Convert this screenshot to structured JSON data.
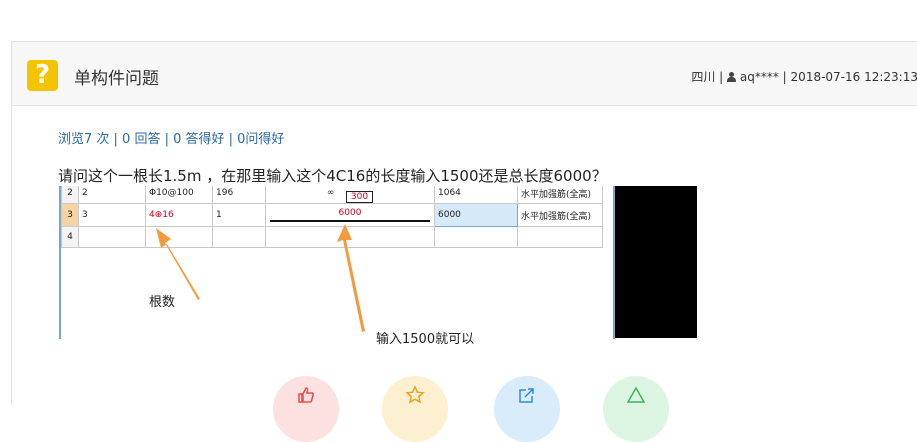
{
  "header": {
    "icon": "question-mark-icon",
    "icon_glyph": "?",
    "title": "单构件问题",
    "location": "四川",
    "separator": "|",
    "user": "aq****",
    "datetime": "2018-07-16 12:23:13"
  },
  "stats": {
    "text": "浏览7 次 | 0 回答 | 0 答得好 | 0问得好"
  },
  "question": {
    "text": "请问这个一根长1.5m ，在那里输入这个4C16的长度输入1500还是总长度6000？"
  },
  "embedded_screenshot": {
    "rows": [
      {
        "num": "2",
        "c1": "2",
        "c2": "Φ10@100",
        "c3": "196",
        "c4": "∞",
        "c4_box": "300",
        "c5": "1064",
        "c6": "水平加强筋(全高)"
      },
      {
        "num": "3",
        "c1": "3",
        "c2": "4⊕16",
        "c3": "1",
        "c4": "6000",
        "c5": "6000",
        "c6": "水平加强筋(全高)"
      },
      {
        "num": "4",
        "c1": "",
        "c2": "",
        "c3": "",
        "c4": "",
        "c5": "",
        "c6": ""
      }
    ],
    "annotations": {
      "left": "根数",
      "right": "输入1500就可以"
    }
  },
  "actions": [
    {
      "name": "like-icon",
      "color": "#fde0e0",
      "stroke": "#e94b4b"
    },
    {
      "name": "star-icon",
      "color": "#fdf0d0",
      "stroke": "#f0a020"
    },
    {
      "name": "share-icon",
      "color": "#d8ecfb",
      "stroke": "#2e8fd8"
    },
    {
      "name": "report-icon",
      "color": "#dcf5e2",
      "stroke": "#3cb45a"
    }
  ],
  "colors": {
    "accent_icon": "#f5c400",
    "link": "#2b6aa8",
    "arrow": "#f59a3c"
  }
}
